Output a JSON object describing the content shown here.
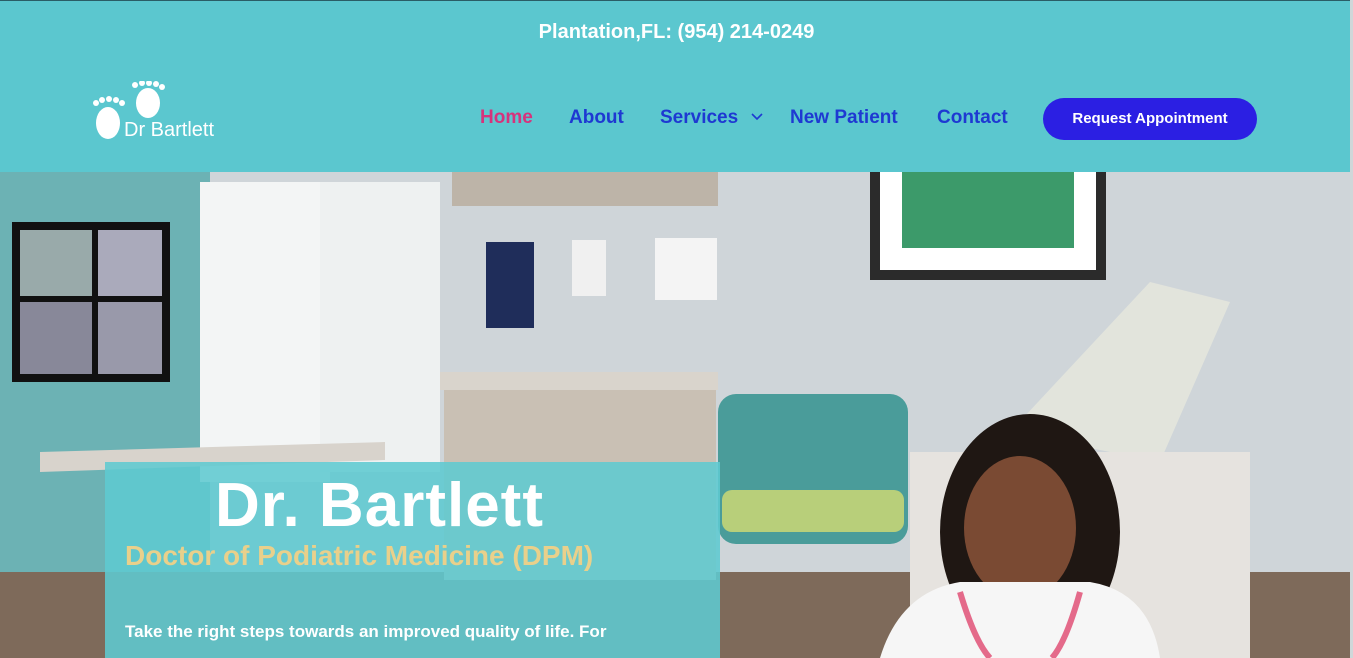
{
  "topbar": {
    "phone_line": "Plantation,FL: (954) 214-0249"
  },
  "brand": {
    "logo_text": "Dr Bartlett"
  },
  "nav": {
    "items": [
      {
        "label": "Home",
        "active": true
      },
      {
        "label": "About"
      },
      {
        "label": "Services",
        "has_dropdown": true
      },
      {
        "label": "New Patient"
      },
      {
        "label": "Contact"
      }
    ],
    "cta_label": "Request Appointment"
  },
  "hero": {
    "title": "Dr. Bartlett",
    "subtitle": "Doctor of Podiatric Medicine (DPM)",
    "body": "Take the right steps towards an improved quality of life. For"
  },
  "icons": {
    "logo": "feet-logo-icon",
    "dropdown": "chevron-down-icon"
  },
  "colors": {
    "header_bg": "#5bc7cf",
    "nav_text": "#1e39d2",
    "nav_active": "#d6337c",
    "cta_bg": "#2b1fe3",
    "subtitle": "#e9d08b"
  }
}
